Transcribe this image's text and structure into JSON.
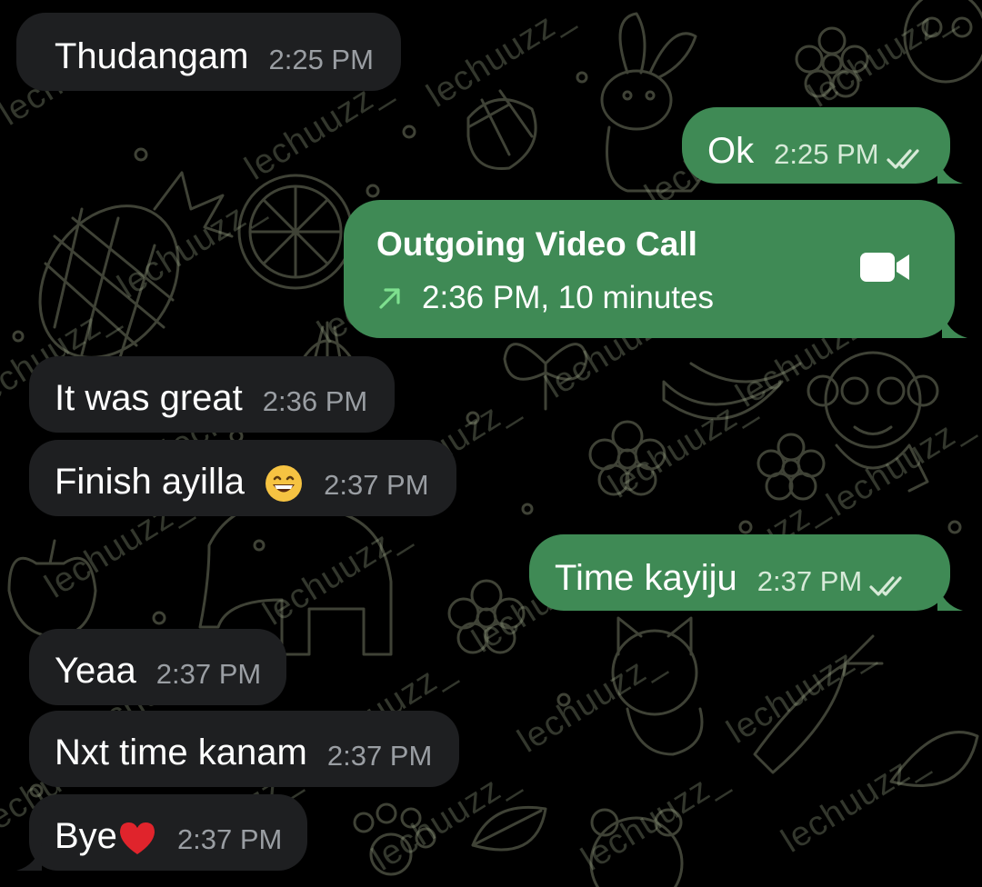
{
  "chat": {
    "messages": [
      {
        "direction": "incoming",
        "text": "Thudangam",
        "time": "2:25 PM"
      },
      {
        "direction": "outgoing",
        "text": "Ok",
        "time": "2:25 PM",
        "status_icon": "double-check-icon"
      },
      {
        "direction": "incoming",
        "text": "It was great",
        "time": "2:36 PM"
      },
      {
        "direction": "incoming",
        "text": "Finish ayilla",
        "emoji": "😄",
        "time": "2:37 PM"
      },
      {
        "direction": "outgoing",
        "text": "Time kayiju",
        "time": "2:37 PM",
        "status_icon": "double-check-icon"
      },
      {
        "direction": "incoming",
        "text": "Yeaa",
        "time": "2:37 PM"
      },
      {
        "direction": "incoming",
        "text": "Nxt time kanam",
        "time": "2:37 PM"
      },
      {
        "direction": "incoming",
        "text": "Bye",
        "emoji": "❤️",
        "time": "2:37 PM"
      }
    ],
    "call": {
      "title": "Outgoing Video Call",
      "detail": "2:36 PM, 10 minutes",
      "direction_icon": "arrow-up-right-icon",
      "type_icon": "video-camera-icon"
    },
    "watermark_text": "lechuuzz_"
  },
  "colors": {
    "background": "#000000",
    "incoming_bubble": "#1e1f21",
    "outgoing_bubble": "#3f8a55",
    "call_arrow": "#7ee08f",
    "doodle_stroke": "#3a3d33"
  }
}
